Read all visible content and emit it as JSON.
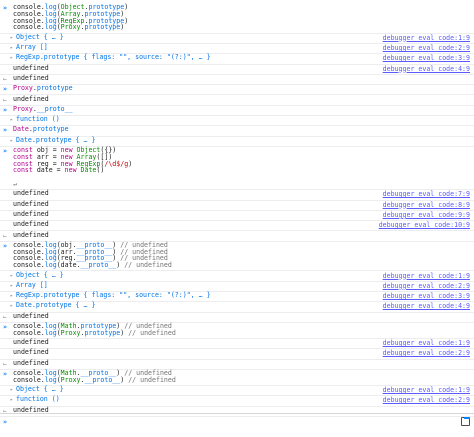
{
  "console": {
    "entries": [
      {
        "kind": "input",
        "lines": [
          [
            [
              "console.",
              ""
            ],
            [
              "log",
              "blue"
            ],
            [
              "(",
              ""
            ],
            [
              "Object",
              "green"
            ],
            [
              ".",
              ""
            ],
            [
              "prototype",
              "blue"
            ],
            [
              ")",
              ""
            ]
          ],
          [
            [
              "console.",
              ""
            ],
            [
              "log",
              "blue"
            ],
            [
              "(",
              ""
            ],
            [
              "Array",
              "green"
            ],
            [
              ".",
              ""
            ],
            [
              "prototype",
              "blue"
            ],
            [
              ")",
              ""
            ]
          ],
          [
            [
              "console.",
              ""
            ],
            [
              "log",
              "blue"
            ],
            [
              "(",
              ""
            ],
            [
              "RegExp",
              "green"
            ],
            [
              ".",
              ""
            ],
            [
              "prototype",
              "blue"
            ],
            [
              ")",
              ""
            ]
          ],
          [
            [
              "console.",
              ""
            ],
            [
              "log",
              "blue"
            ],
            [
              "(",
              ""
            ],
            [
              "Proxy",
              "green"
            ],
            [
              ".",
              ""
            ],
            [
              "prototype",
              "blue"
            ],
            [
              ")",
              ""
            ]
          ]
        ]
      },
      {
        "kind": "object",
        "text": "Object { … }",
        "source": "debugger eval code:1:9"
      },
      {
        "kind": "object",
        "text": "Array []",
        "source": "debugger eval code:2:9"
      },
      {
        "kind": "object",
        "text": "RegExp.prototype { flags: \"\", source: \"(?:)\", … }",
        "source": "debugger eval code:3:9"
      },
      {
        "kind": "log",
        "text": "undefined",
        "source": "debugger eval code:4:9"
      },
      {
        "kind": "result",
        "text": "undefined"
      },
      {
        "kind": "input",
        "lines": [
          [
            [
              "Proxy",
              "purple"
            ],
            [
              ".",
              ""
            ],
            [
              "prototype",
              "blue"
            ]
          ]
        ]
      },
      {
        "kind": "result",
        "text": "undefined"
      },
      {
        "kind": "input",
        "lines": [
          [
            [
              "Proxy",
              "purple"
            ],
            [
              ".",
              ""
            ],
            [
              "__proto__",
              "blue"
            ]
          ]
        ]
      },
      {
        "kind": "object",
        "text": "function ()"
      },
      {
        "kind": "input",
        "lines": [
          [
            [
              "Date",
              "purple"
            ],
            [
              ".",
              ""
            ],
            [
              "prototype",
              "blue"
            ]
          ]
        ]
      },
      {
        "kind": "object",
        "text": "Date.prototype { … }"
      },
      {
        "kind": "input",
        "lines": [
          [
            [
              "const ",
              "purple"
            ],
            [
              "obj = ",
              ""
            ],
            [
              "new ",
              "purple"
            ],
            [
              "Object",
              "green"
            ],
            [
              "({})",
              ""
            ]
          ],
          [
            [
              "const ",
              "purple"
            ],
            [
              "arr = ",
              ""
            ],
            [
              "new ",
              "purple"
            ],
            [
              "Array",
              "green"
            ],
            [
              "([])",
              ""
            ]
          ],
          [
            [
              "const ",
              "purple"
            ],
            [
              "reg = ",
              ""
            ],
            [
              "new ",
              "purple"
            ],
            [
              "RegExp",
              "green"
            ],
            [
              "(",
              ""
            ],
            [
              "/\\d$/g",
              "red"
            ],
            [
              ")",
              ""
            ]
          ],
          [
            [
              "const ",
              "purple"
            ],
            [
              "date = ",
              ""
            ],
            [
              "new ",
              "purple"
            ],
            [
              "Date",
              "green"
            ],
            [
              "()",
              ""
            ]
          ],
          [
            [
              "",
              ""
            ]
          ],
          [
            [
              "↵",
              "gray"
            ]
          ]
        ]
      },
      {
        "kind": "log",
        "text": "undefined",
        "source": "debugger eval code:7:9"
      },
      {
        "kind": "log",
        "text": "undefined",
        "source": "debugger eval code:8:9"
      },
      {
        "kind": "log",
        "text": "undefined",
        "source": "debugger eval code:9:9"
      },
      {
        "kind": "log",
        "text": "undefined",
        "source": "debugger eval code:10:9"
      },
      {
        "kind": "result",
        "text": "undefined"
      },
      {
        "kind": "input",
        "lines": [
          [
            [
              "console.",
              ""
            ],
            [
              "log",
              "blue"
            ],
            [
              "(obj.",
              ""
            ],
            [
              "__proto__",
              "blue"
            ],
            [
              ") ",
              ""
            ],
            [
              "// undefined",
              "gray"
            ]
          ],
          [
            [
              "console.",
              ""
            ],
            [
              "log",
              "blue"
            ],
            [
              "(arr.",
              ""
            ],
            [
              "__proto__",
              "blue"
            ],
            [
              ") ",
              ""
            ],
            [
              "// undefined",
              "gray"
            ]
          ],
          [
            [
              "console.",
              ""
            ],
            [
              "log",
              "blue"
            ],
            [
              "(reg.",
              ""
            ],
            [
              "__proto__",
              "blue"
            ],
            [
              ") ",
              ""
            ],
            [
              "// undefined",
              "gray"
            ]
          ],
          [
            [
              "console.",
              ""
            ],
            [
              "log",
              "blue"
            ],
            [
              "(date.",
              ""
            ],
            [
              "__proto__",
              "blue"
            ],
            [
              ") ",
              ""
            ],
            [
              "// undefined",
              "gray"
            ]
          ]
        ]
      },
      {
        "kind": "object",
        "text": "Object { … }",
        "source": "debugger eval code:1:9"
      },
      {
        "kind": "object",
        "text": "Array []",
        "source": "debugger eval code:2:9"
      },
      {
        "kind": "object",
        "text": "RegExp.prototype { flags: \"\", source: \"(?:)\", … }",
        "source": "debugger eval code:3:9"
      },
      {
        "kind": "object",
        "text": "Date.prototype { … }",
        "source": "debugger eval code:4:9"
      },
      {
        "kind": "result",
        "text": "undefined"
      },
      {
        "kind": "input",
        "lines": [
          [
            [
              "console.",
              ""
            ],
            [
              "log",
              "blue"
            ],
            [
              "(",
              ""
            ],
            [
              "Math",
              "green"
            ],
            [
              ".",
              ""
            ],
            [
              "prototype",
              "blue"
            ],
            [
              ") ",
              ""
            ],
            [
              "// undefined",
              "gray"
            ]
          ],
          [
            [
              "console.",
              ""
            ],
            [
              "log",
              "blue"
            ],
            [
              "(",
              ""
            ],
            [
              "Proxy",
              "green"
            ],
            [
              ".",
              ""
            ],
            [
              "prototype",
              "blue"
            ],
            [
              ") ",
              ""
            ],
            [
              "// undefined",
              "gray"
            ]
          ]
        ]
      },
      {
        "kind": "log",
        "text": "undefined",
        "source": "debugger eval code:1:9"
      },
      {
        "kind": "log",
        "text": "undefined",
        "source": "debugger eval code:2:9"
      },
      {
        "kind": "result",
        "text": "undefined"
      },
      {
        "kind": "input",
        "lines": [
          [
            [
              "console.",
              ""
            ],
            [
              "log",
              "blue"
            ],
            [
              "(",
              ""
            ],
            [
              "Math",
              "green"
            ],
            [
              ".",
              ""
            ],
            [
              "__proto__",
              "blue"
            ],
            [
              ") ",
              ""
            ],
            [
              "// undefined",
              "gray"
            ]
          ],
          [
            [
              "console.",
              ""
            ],
            [
              "log",
              "blue"
            ],
            [
              "(",
              ""
            ],
            [
              "Proxy",
              "green"
            ],
            [
              ".",
              ""
            ],
            [
              "__proto__",
              "blue"
            ],
            [
              ") ",
              ""
            ],
            [
              "// undefined",
              "gray"
            ]
          ]
        ]
      },
      {
        "kind": "object",
        "text": "Object { … }",
        "source": "debugger eval code:1:9"
      },
      {
        "kind": "object",
        "text": "function ()",
        "source": "debugger eval code:2:9"
      },
      {
        "kind": "result",
        "text": "undefined"
      }
    ]
  },
  "input_bar": {
    "prompt": "»"
  },
  "icons": {
    "input": "»",
    "result": "←",
    "expand": "▸"
  },
  "colors": {
    "prompt": "#0a84ff",
    "source_link": "#5a5aff",
    "keyword": "#b3028e",
    "builtin": "#058b00",
    "property": "#0074e8"
  }
}
